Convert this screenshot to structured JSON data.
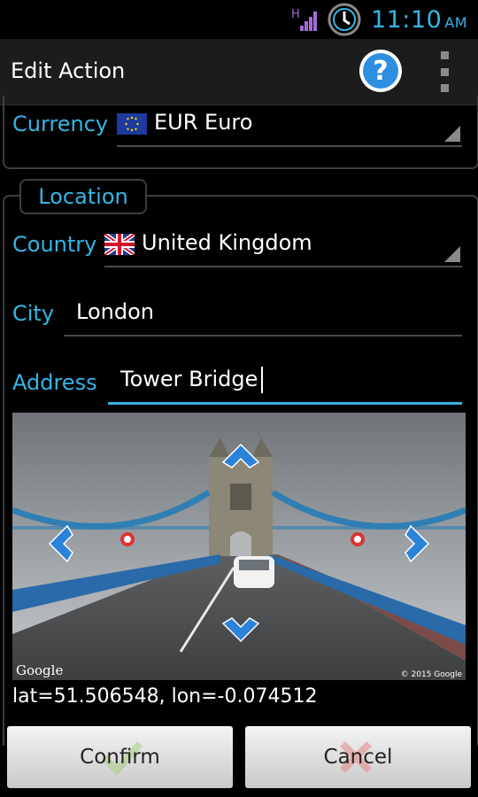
{
  "status_bar": {
    "time": "11:10",
    "ampm": "AM",
    "network": "H"
  },
  "action_bar": {
    "title": "Edit Action",
    "help_icon": "question-mark-icon",
    "overflow_icon": "overflow-menu-icon"
  },
  "currency": {
    "label": "Currency",
    "value": "EUR Euro",
    "flag_icon": "eu-flag-icon"
  },
  "location": {
    "legend": "Location",
    "country": {
      "label": "Country",
      "value": "United Kingdom",
      "flag_icon": "uk-flag-icon"
    },
    "city": {
      "label": "City",
      "value": "London"
    },
    "address": {
      "label": "Address",
      "value": "Tower Bridge"
    }
  },
  "street_view": {
    "watermark_left": "Google",
    "watermark_right": "© 2015 Google"
  },
  "coordinates": "lat=51.506548, lon=-0.074512",
  "buttons": {
    "confirm": "Confirm",
    "cancel": "Cancel"
  },
  "colors": {
    "accent": "#35b5e5",
    "background": "#000000",
    "actionbar": "#1c1c1c",
    "button": "#dcdcdc"
  }
}
